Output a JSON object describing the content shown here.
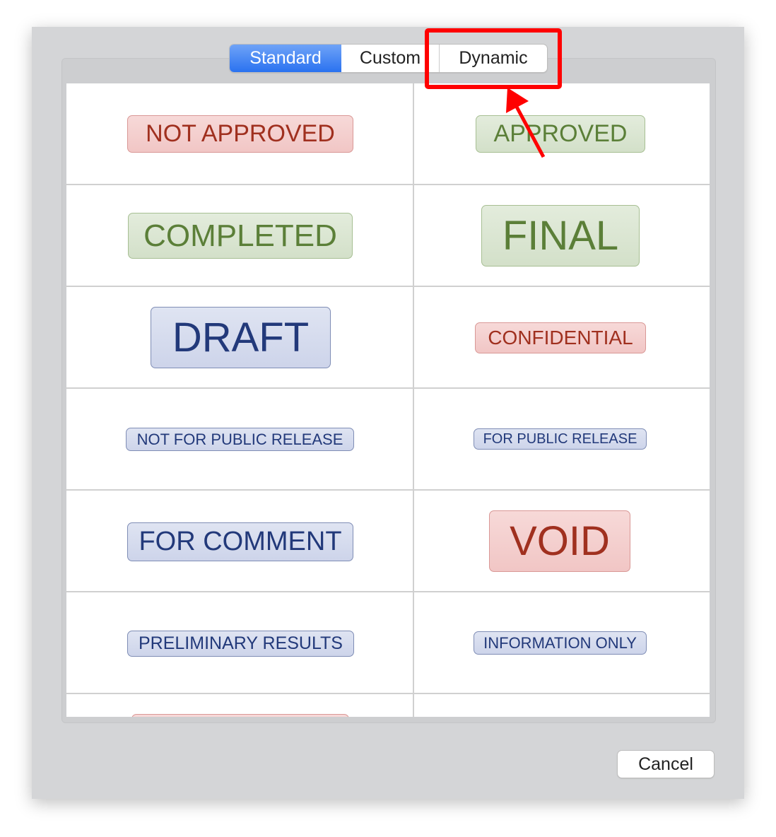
{
  "tabs": [
    {
      "label": "Standard",
      "selected": true
    },
    {
      "label": "Custom",
      "selected": false
    },
    {
      "label": "Dynamic",
      "selected": false
    }
  ],
  "stamps": [
    {
      "text": "NOT APPROVED",
      "color": "red"
    },
    {
      "text": "APPROVED",
      "color": "green"
    },
    {
      "text": "COMPLETED",
      "color": "green"
    },
    {
      "text": "FINAL",
      "color": "green"
    },
    {
      "text": "DRAFT",
      "color": "blue"
    },
    {
      "text": "CONFIDENTIAL",
      "color": "red"
    },
    {
      "text": "NOT FOR PUBLIC RELEASE",
      "color": "blue"
    },
    {
      "text": "FOR PUBLIC RELEASE",
      "color": "blue"
    },
    {
      "text": "FOR COMMENT",
      "color": "blue"
    },
    {
      "text": "VOID",
      "color": "red"
    },
    {
      "text": "PRELIMINARY RESULTS",
      "color": "blue"
    },
    {
      "text": "INFORMATION ONLY",
      "color": "blue"
    }
  ],
  "cancel_label": "Cancel",
  "annotation_color": "#ff0000"
}
